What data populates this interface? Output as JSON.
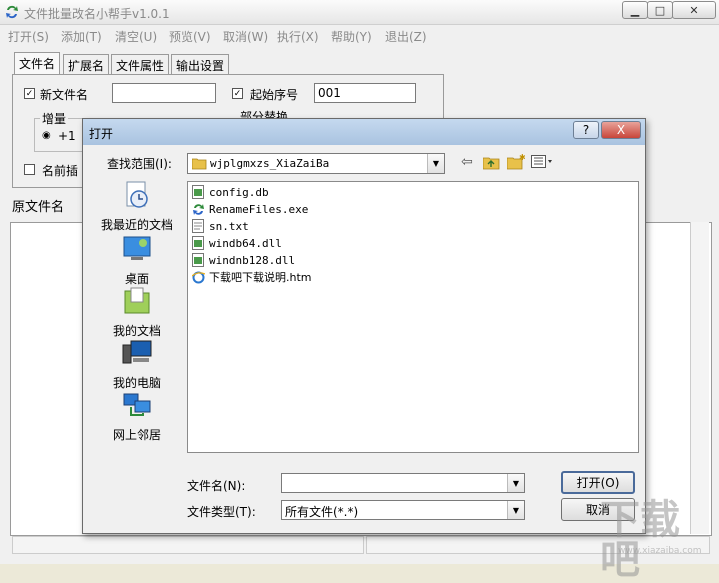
{
  "main": {
    "title": "文件批量改名小帮手v1.0.1",
    "menu": [
      "打开(S)",
      "添加(T)",
      "清空(U)",
      "预览(V)",
      "取消(W)",
      "执行(X)",
      "帮助(Y)",
      "退出(Z)"
    ],
    "tabs": [
      "文件名",
      "扩展名",
      "文件属性",
      "输出设置"
    ],
    "new_name_label": "新文件名",
    "new_name_value": "",
    "start_seq_label": "起始序号",
    "start_seq_value": "001",
    "increment_label": "增量",
    "increment_option": "+1",
    "partial_replace_label": "部分替换",
    "prefix_label": "名前插",
    "list_header": "原文件名"
  },
  "dialog": {
    "title": "打开",
    "help_btn": "?",
    "close_btn": "X",
    "lookin_label": "查找范围(I):",
    "lookin_value": "wjplgmxzs_XiaZaiBa",
    "places": [
      "我最近的文档",
      "桌面",
      "我的文档",
      "我的电脑",
      "网上邻居"
    ],
    "files": [
      {
        "name": "config.db",
        "icon": "db-file-icon"
      },
      {
        "name": "RenameFiles.exe",
        "icon": "exe-icon"
      },
      {
        "name": "sn.txt",
        "icon": "text-file-icon"
      },
      {
        "name": "windb64.dll",
        "icon": "dll-icon"
      },
      {
        "name": "windnb128.dll",
        "icon": "dll-icon"
      },
      {
        "name": "下载吧下载说明.htm",
        "icon": "ie-icon"
      }
    ],
    "filename_label": "文件名(N):",
    "filename_value": "",
    "filetype_label": "文件类型(T):",
    "filetype_value": "所有文件(*.*)",
    "open_btn": "打开(O)",
    "cancel_btn": "取消"
  },
  "watermark": {
    "text": "下载吧",
    "url": "www.xiazaiba.com"
  },
  "colors": {
    "dialog_title": "#b7cde8",
    "window_bg": "#f0f0f0",
    "disabled_text": "#8a8a8a"
  }
}
